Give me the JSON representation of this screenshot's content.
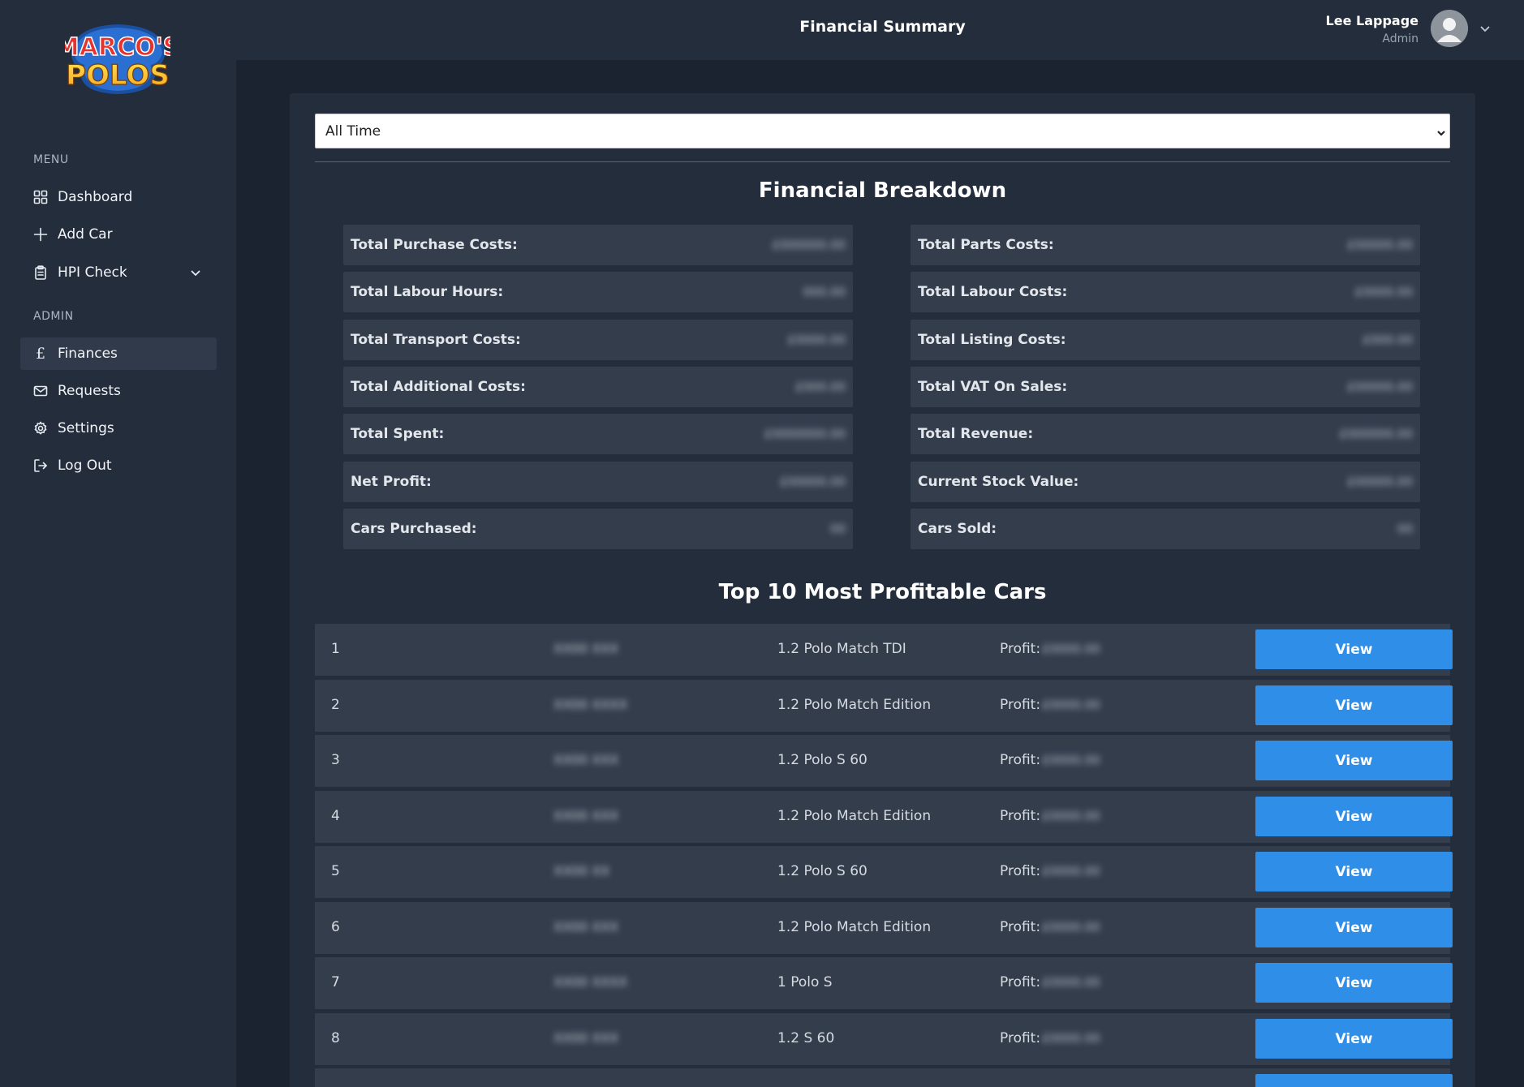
{
  "app": {
    "logo_text": "MARCO'S POLOS",
    "page_title": "Financial Summary"
  },
  "sidebar": {
    "menu_heading": "MENU",
    "admin_heading": "ADMIN",
    "menu_items": [
      {
        "label": "Dashboard",
        "icon": "grid-icon"
      },
      {
        "label": "Add Car",
        "icon": "plus-icon"
      },
      {
        "label": "HPI Check",
        "icon": "clipboard-icon"
      }
    ],
    "admin_items": [
      {
        "label": "Finances",
        "icon": "pound-icon",
        "active": true
      },
      {
        "label": "Requests",
        "icon": "mail-icon"
      },
      {
        "label": "Settings",
        "icon": "gear-icon"
      },
      {
        "label": "Log Out",
        "icon": "logout-icon"
      }
    ]
  },
  "user": {
    "name": "Lee Lappage",
    "role": "Admin"
  },
  "filter": {
    "selected": "All Time"
  },
  "breakdown": {
    "title": "Financial Breakdown",
    "left": [
      {
        "label": "Total Purchase Costs:",
        "value": "£000000.00"
      },
      {
        "label": "Total Labour Hours:",
        "value": "000.00"
      },
      {
        "label": "Total Transport Costs:",
        "value": "£0000.00"
      },
      {
        "label": "Total Additional Costs:",
        "value": "£000.00"
      },
      {
        "label": "Total Spent:",
        "value": "£0000000.00"
      },
      {
        "label": "Net Profit:",
        "value": "£00000.00"
      },
      {
        "label": "Cars Purchased:",
        "value": "00"
      }
    ],
    "right": [
      {
        "label": "Total Parts Costs:",
        "value": "£00000.00"
      },
      {
        "label": "Total Labour Costs:",
        "value": "£0000.00"
      },
      {
        "label": "Total Listing Costs:",
        "value": "£000.00"
      },
      {
        "label": "Total VAT On Sales:",
        "value": "£00000.00"
      },
      {
        "label": "Total Revenue:",
        "value": "£000000.00"
      },
      {
        "label": "Current Stock Value:",
        "value": "£00000.00"
      },
      {
        "label": "Cars Sold:",
        "value": "00"
      }
    ]
  },
  "top_cars": {
    "title": "Top 10 Most Profitable Cars",
    "profit_label": "Profit:",
    "view_label": "View",
    "rows": [
      {
        "rank": "1",
        "reg": "XX00 XXX",
        "model": "1.2 Polo Match TDI",
        "profit": "£0000.00"
      },
      {
        "rank": "2",
        "reg": "XX00 XXXX",
        "model": "1.2 Polo Match Edition",
        "profit": "£0000.00"
      },
      {
        "rank": "3",
        "reg": "XX00 XXX",
        "model": "1.2 Polo S 60",
        "profit": "£0000.00"
      },
      {
        "rank": "4",
        "reg": "XX00 XXX",
        "model": "1.2 Polo Match Edition",
        "profit": "£0000.00"
      },
      {
        "rank": "5",
        "reg": "XX00 XX",
        "model": "1.2 Polo S 60",
        "profit": "£0000.00"
      },
      {
        "rank": "6",
        "reg": "XX00 XXX",
        "model": "1.2 Polo Match Edition",
        "profit": "£0000.00"
      },
      {
        "rank": "7",
        "reg": "XX00 XXXX",
        "model": "1 Polo S",
        "profit": "£0000.00"
      },
      {
        "rank": "8",
        "reg": "XX00 XXX",
        "model": "1.2 S 60",
        "profit": "£0000.00"
      }
    ]
  }
}
